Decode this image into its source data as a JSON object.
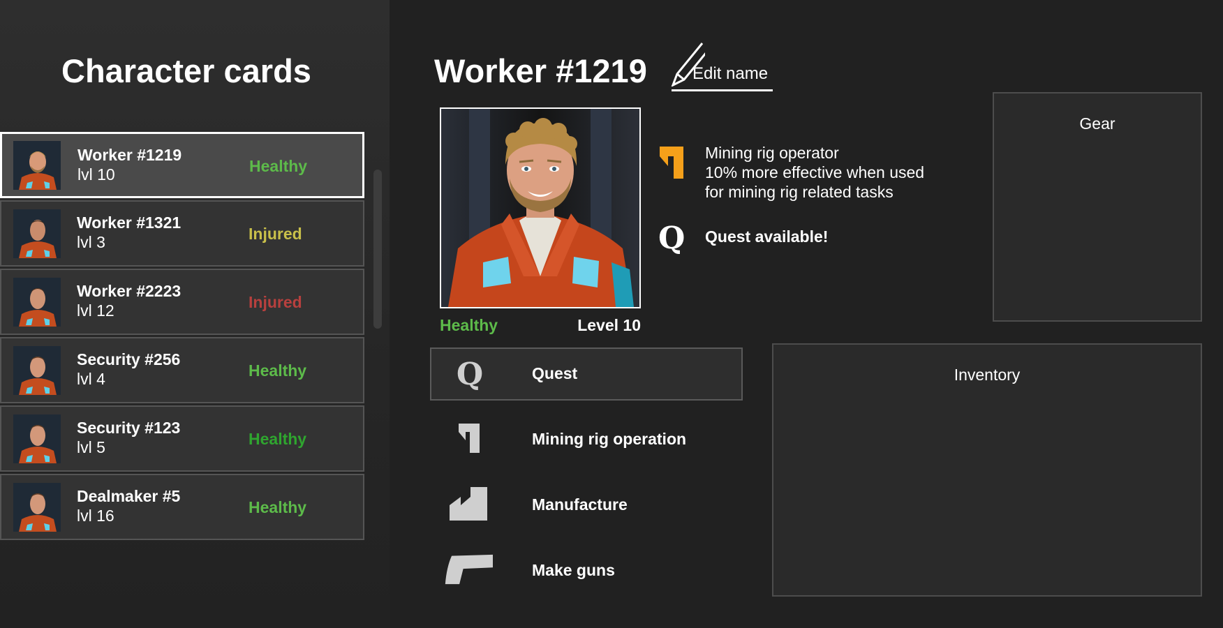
{
  "left": {
    "title": "Character cards"
  },
  "cards": [
    {
      "name": "Worker #1219",
      "level": "lvl 10",
      "status": "Healthy",
      "status_color": "#5dbb4a",
      "selected": true
    },
    {
      "name": "Worker #1321",
      "level": "lvl 3",
      "status": "Injured",
      "status_color": "#c9c04a",
      "selected": false
    },
    {
      "name": "Worker #2223",
      "level": "lvl 12",
      "status": "Injured",
      "status_color": "#b8403e",
      "selected": false
    },
    {
      "name": "Security #256",
      "level": "lvl 4",
      "status": "Healthy",
      "status_color": "#5dbb4a",
      "selected": false
    },
    {
      "name": "Security #123",
      "level": "lvl 5",
      "status": "Healthy",
      "status_color": "#2fa52f",
      "selected": false
    },
    {
      "name": "Dealmaker #5",
      "level": "lvl 16",
      "status": "Healthy",
      "status_color": "#5dbb4a",
      "selected": false
    }
  ],
  "detail": {
    "title": "Worker #1219",
    "edit_label": "Edit name",
    "health": "Healthy",
    "level": "Level 10",
    "trait_line1": "Mining rig operator",
    "trait_line2": "10% more effective when used",
    "trait_line3": "for mining rig related tasks",
    "quest_icon": "Q",
    "quest_available": "Quest available!",
    "gear_title": "Gear",
    "inventory_title": "Inventory"
  },
  "tasks": [
    {
      "label": "Quest",
      "icon": "quest-icon",
      "glyph": "Q"
    },
    {
      "label": "Mining rig operation",
      "icon": "mining-rig-icon"
    },
    {
      "label": "Manufacture",
      "icon": "factory-icon"
    },
    {
      "label": "Make guns",
      "icon": "gun-icon"
    }
  ],
  "colors": {
    "healthy": "#5dbb4a",
    "trait_accent": "#f5a01a",
    "icon_gray": "#cfcfcf"
  }
}
